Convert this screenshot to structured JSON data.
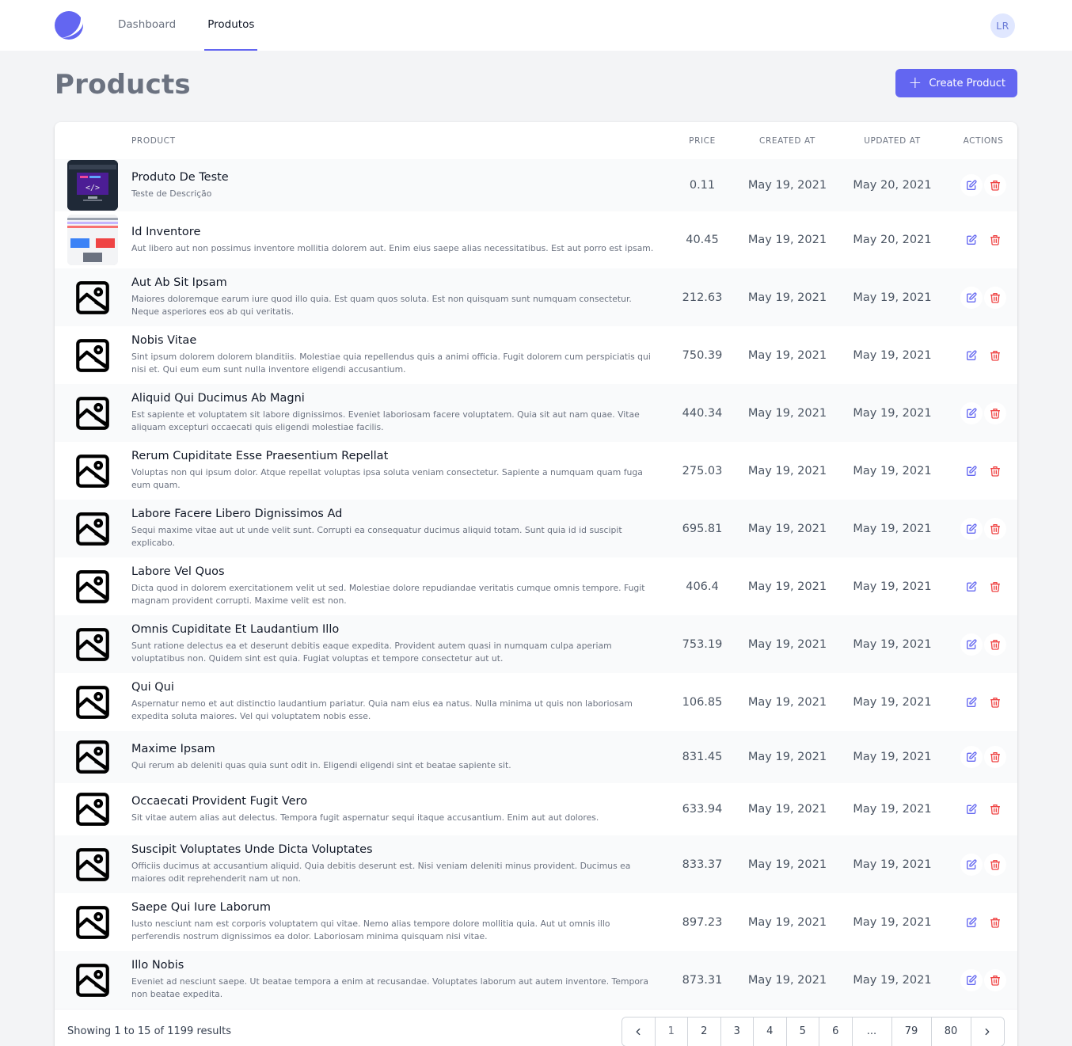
{
  "nav": {
    "links": [
      "Dashboard",
      "Produtos"
    ],
    "active": 1,
    "avatar_initials": "LR"
  },
  "header": {
    "title": "Products",
    "create_label": "Create Product"
  },
  "table": {
    "columns": [
      "Product",
      "Price",
      "Created At",
      "Updated At",
      "Actions"
    ],
    "rows": [
      {
        "name": "Produto De Teste",
        "desc": "Teste de Descrição",
        "price": "0.11",
        "created": "May 19, 2021",
        "updated": "May 20, 2021",
        "thumb": "photo1"
      },
      {
        "name": "Id Inventore",
        "desc": "Aut libero aut non possimus inventore mollitia dolorem aut. Enim eius saepe alias necessitatibus. Est aut porro est ipsam.",
        "price": "40.45",
        "created": "May 19, 2021",
        "updated": "May 20, 2021",
        "thumb": "photo2"
      },
      {
        "name": "Aut Ab Sit Ipsam",
        "desc": "Maiores doloremque earum iure quod illo quia. Est quam quos soluta. Est non quisquam sunt numquam consectetur. Neque asperiores eos ab qui veritatis.",
        "price": "212.63",
        "created": "May 19, 2021",
        "updated": "May 19, 2021",
        "thumb": "placeholder"
      },
      {
        "name": "Nobis Vitae",
        "desc": "Sint ipsum dolorem dolorem blanditiis. Molestiae quia repellendus quis a animi officia. Fugit dolorem cum perspiciatis qui nisi et. Qui eum eum sunt nulla inventore eligendi accusantium.",
        "price": "750.39",
        "created": "May 19, 2021",
        "updated": "May 19, 2021",
        "thumb": "placeholder"
      },
      {
        "name": "Aliquid Qui Ducimus Ab Magni",
        "desc": "Est sapiente et voluptatem sit labore dignissimos. Eveniet laboriosam facere voluptatem. Quia sit aut nam quae. Vitae aliquam excepturi occaecati quis eligendi molestiae facilis.",
        "price": "440.34",
        "created": "May 19, 2021",
        "updated": "May 19, 2021",
        "thumb": "placeholder"
      },
      {
        "name": "Rerum Cupiditate Esse Praesentium Repellat",
        "desc": "Voluptas non qui ipsum dolor. Atque repellat voluptas ipsa soluta veniam consectetur. Sapiente a numquam quam fuga eum quam.",
        "price": "275.03",
        "created": "May 19, 2021",
        "updated": "May 19, 2021",
        "thumb": "placeholder"
      },
      {
        "name": "Labore Facere Libero Dignissimos Ad",
        "desc": "Sequi maxime vitae aut ut unde velit sunt. Corrupti ea consequatur ducimus aliquid totam. Sunt quia id id suscipit explicabo.",
        "price": "695.81",
        "created": "May 19, 2021",
        "updated": "May 19, 2021",
        "thumb": "placeholder"
      },
      {
        "name": "Labore Vel Quos",
        "desc": "Dicta quod in dolorem exercitationem velit ut sed. Molestiae dolore repudiandae veritatis cumque omnis tempore. Fugit magnam provident corrupti. Maxime velit est non.",
        "price": "406.4",
        "created": "May 19, 2021",
        "updated": "May 19, 2021",
        "thumb": "placeholder"
      },
      {
        "name": "Omnis Cupiditate Et Laudantium Illo",
        "desc": "Sunt ratione delectus ea et deserunt debitis eaque expedita. Provident autem quasi in numquam culpa aperiam voluptatibus non. Quidem sint est quia. Fugiat voluptas et tempore consectetur aut ut.",
        "price": "753.19",
        "created": "May 19, 2021",
        "updated": "May 19, 2021",
        "thumb": "placeholder"
      },
      {
        "name": "Qui Qui",
        "desc": "Aspernatur nemo et aut distinctio laudantium pariatur. Quia nam eius ea natus. Nulla minima ut quis non laboriosam expedita soluta maiores. Vel qui voluptatem nobis esse.",
        "price": "106.85",
        "created": "May 19, 2021",
        "updated": "May 19, 2021",
        "thumb": "placeholder"
      },
      {
        "name": "Maxime Ipsam",
        "desc": "Qui rerum ab deleniti quas quia sunt odit in. Eligendi eligendi sint et beatae sapiente sit.",
        "price": "831.45",
        "created": "May 19, 2021",
        "updated": "May 19, 2021",
        "thumb": "placeholder"
      },
      {
        "name": "Occaecati Provident Fugit Vero",
        "desc": "Sit vitae autem alias aut delectus. Tempora fugit aspernatur sequi itaque accusantium. Enim aut aut dolores.",
        "price": "633.94",
        "created": "May 19, 2021",
        "updated": "May 19, 2021",
        "thumb": "placeholder"
      },
      {
        "name": "Suscipit Voluptates Unde Dicta Voluptates",
        "desc": "Officiis ducimus at accusantium aliquid. Quia debitis deserunt est. Nisi veniam deleniti minus provident. Ducimus ea maiores odit reprehenderit nam ut non.",
        "price": "833.37",
        "created": "May 19, 2021",
        "updated": "May 19, 2021",
        "thumb": "placeholder"
      },
      {
        "name": "Saepe Qui Iure Laborum",
        "desc": "Iusto nesciunt nam est corporis voluptatem qui vitae. Nemo alias tempore dolore mollitia quia. Aut ut omnis illo perferendis nostrum dignissimos ea dolor. Laboriosam minima quisquam nisi vitae.",
        "price": "897.23",
        "created": "May 19, 2021",
        "updated": "May 19, 2021",
        "thumb": "placeholder"
      },
      {
        "name": "Illo Nobis",
        "desc": "Eveniet ad nesciunt saepe. Ut beatae tempora a enim at recusandae. Voluptates laborum aut autem inventore. Tempora non beatae expedita.",
        "price": "873.31",
        "created": "May 19, 2021",
        "updated": "May 19, 2021",
        "thumb": "placeholder"
      }
    ]
  },
  "footer": {
    "showing": "Showing 1 to 15 of 1199 results",
    "pages": [
      "1",
      "2",
      "3",
      "4",
      "5",
      "6",
      "...",
      "79",
      "80"
    ],
    "current_page": "1"
  },
  "colors": {
    "accent": "#6366f1",
    "edit_icon": "#6366f1",
    "delete_icon": "#ef4444"
  },
  "icons": {
    "logo": "moon-logo-icon",
    "create": "plus-icon",
    "edit": "pencil-square-icon",
    "delete": "trash-icon",
    "prev": "chevron-left-icon",
    "next": "chevron-right-icon",
    "placeholder": "image-placeholder-icon"
  }
}
